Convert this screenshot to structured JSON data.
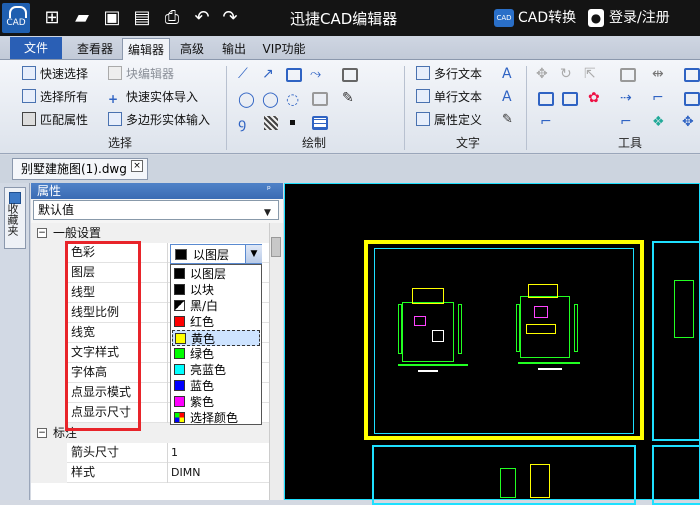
{
  "titlebar": {
    "logo_text": "CAD",
    "app_title": "迅捷CAD编辑器",
    "cad_convert_icon_text": "CAD",
    "cad_convert": "CAD转换",
    "login": "登录/注册"
  },
  "menu": {
    "tabs": [
      {
        "label": "文件"
      },
      {
        "label": "查看器"
      },
      {
        "label": "编辑器"
      },
      {
        "label": "高级"
      },
      {
        "label": "输出"
      },
      {
        "label": "VIP功能"
      }
    ],
    "active": "编辑器"
  },
  "ribbon": {
    "select_group": {
      "name": "选择",
      "items": [
        "快速选择",
        "选择所有",
        "匹配属性"
      ]
    },
    "block_group": {
      "items": [
        "块编辑器",
        "快速实体导入",
        "多边形实体输入"
      ]
    },
    "draw_group": {
      "name": "绘制"
    },
    "text_group": {
      "name": "文字",
      "items": [
        "多行文本",
        "单行文本",
        "属性定义"
      ]
    },
    "tools_group": {
      "name": "工具"
    }
  },
  "document": {
    "tab_label": "别墅建施图(1).dwg",
    "close_glyph": "×"
  },
  "side_strip": {
    "label": "收藏夹"
  },
  "properties": {
    "header": "属性",
    "pin_glyph": "ᵖ",
    "scope": "默认值",
    "categories": [
      {
        "toggle": "−",
        "label": "一般设置",
        "rows": [
          {
            "label": "色彩",
            "value": ""
          },
          {
            "label": "图层",
            "value": ""
          },
          {
            "label": "线型",
            "value": ""
          },
          {
            "label": "线型比例",
            "value": ""
          },
          {
            "label": "线宽",
            "value": ""
          },
          {
            "label": "文字样式",
            "value": ""
          },
          {
            "label": "字体高",
            "value": ""
          },
          {
            "label": "点显示模式",
            "value": ""
          },
          {
            "label": "点显示尺寸",
            "value": ""
          }
        ]
      },
      {
        "toggle": "−",
        "label": "标注",
        "rows": [
          {
            "label": "箭头尺寸",
            "value": "1"
          },
          {
            "label": "样式",
            "value": "DIMN"
          }
        ]
      }
    ],
    "color_combo": {
      "selected": "以图层",
      "selected_color": "#000000",
      "options": [
        {
          "label": "以图层",
          "color": "#000000"
        },
        {
          "label": "以块",
          "color": "#000000"
        },
        {
          "label": "黑/白",
          "color": "#000000"
        },
        {
          "label": "红色",
          "color": "#ff0000"
        },
        {
          "label": "黄色",
          "color": "#ffff00"
        },
        {
          "label": "绿色",
          "color": "#00ff00"
        },
        {
          "label": "亮蓝色",
          "color": "#00ffff"
        },
        {
          "label": "蓝色",
          "color": "#0000ff"
        },
        {
          "label": "紫色",
          "color": "#ff00ff"
        },
        {
          "label": "选择颜色",
          "color": "multicolor"
        }
      ],
      "highlighted": "黄色"
    }
  },
  "colors": {
    "accent_blue": "#2a5fb5",
    "highlight_red": "#e8242a",
    "drawing_frame_yellow": "#ffff00",
    "drawing_frame_cyan": "#1ee0ff",
    "drawing_lines_green": "#22ff22"
  }
}
